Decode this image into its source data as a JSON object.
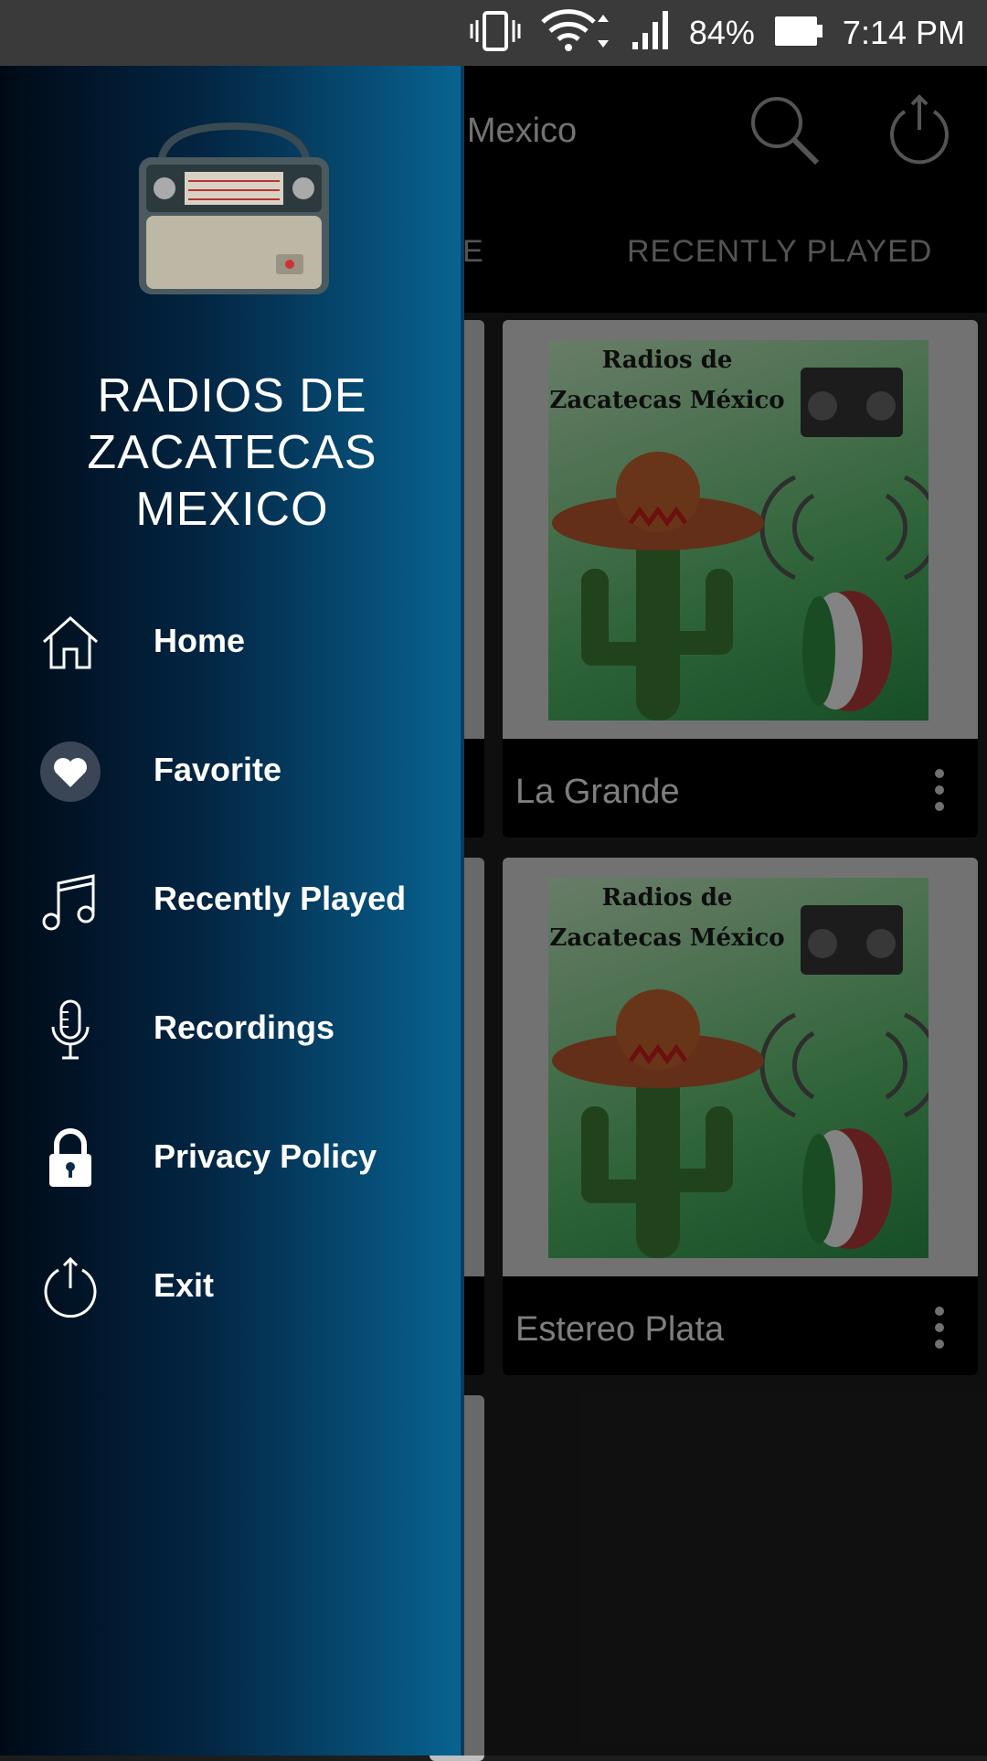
{
  "status_bar": {
    "battery": "84%",
    "time": "7:14 PM"
  },
  "app_bar": {
    "title": "ecas Mexico"
  },
  "tabs": [
    {
      "label": "E"
    },
    {
      "label": "RECENTLY PLAYED"
    }
  ],
  "cards": [
    {
      "art_text": "Radios de Zacatecas México",
      "name": "La Grande"
    },
    {
      "art_text": "Radios de Zacatecas México",
      "name": "Estereo Plata"
    }
  ],
  "drawer": {
    "title_lines": [
      "RADIOS DE",
      "ZACATECAS",
      "MEXICO"
    ],
    "menu": [
      {
        "label": "Home",
        "icon": "home-icon"
      },
      {
        "label": "Favorite",
        "icon": "heart-icon"
      },
      {
        "label": "Recently Played",
        "icon": "music-note-icon"
      },
      {
        "label": "Recordings",
        "icon": "microphone-icon"
      },
      {
        "label": "Privacy Policy",
        "icon": "lock-icon"
      },
      {
        "label": "Exit",
        "icon": "power-icon"
      }
    ]
  },
  "colors": {
    "drawer_dark": "#000a16",
    "drawer_light": "#086391",
    "app_bar": "#000000"
  }
}
